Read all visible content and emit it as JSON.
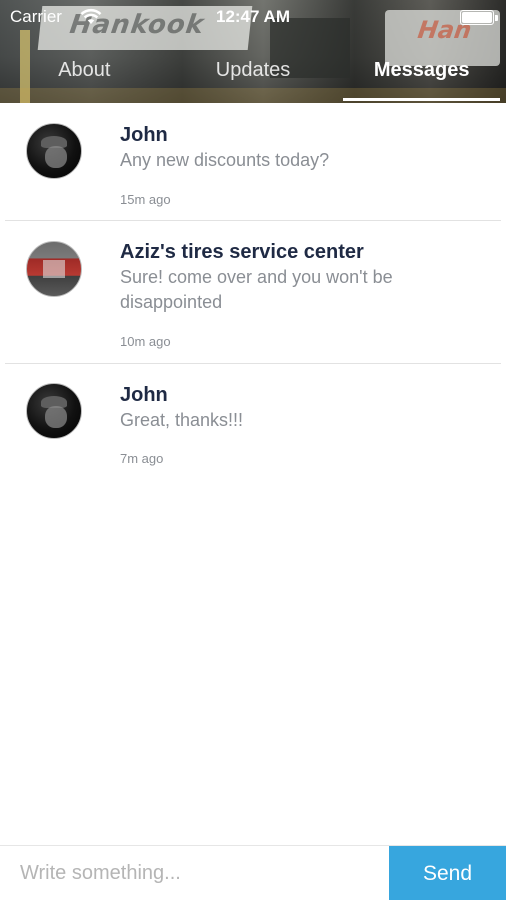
{
  "status_bar": {
    "carrier": "Carrier",
    "time": "12:47 AM"
  },
  "header": {
    "background_texts": [
      "Hankook",
      "Han"
    ],
    "tabs": [
      {
        "label": "About",
        "active": false
      },
      {
        "label": "Updates",
        "active": false
      },
      {
        "label": "Messages",
        "active": true
      }
    ]
  },
  "messages": [
    {
      "name": "John",
      "text": "Any new discounts today?",
      "time": "15m ago",
      "avatar": "john-avatar"
    },
    {
      "name": "Aziz's tires service center",
      "text": "Sure! come over and you won't be disappointed",
      "time": "10m ago",
      "avatar": "shop-avatar"
    },
    {
      "name": "John",
      "text": "Great, thanks!!!",
      "time": "7m ago",
      "avatar": "john-avatar"
    }
  ],
  "composer": {
    "placeholder": "Write something...",
    "send_label": "Send"
  },
  "colors": {
    "accent": "#37a6de",
    "name_text": "#1f2a44",
    "secondary_text": "#8a8e94"
  }
}
